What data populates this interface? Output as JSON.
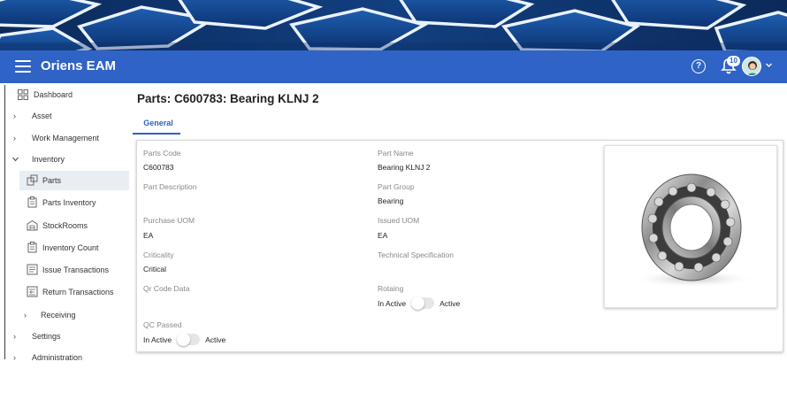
{
  "app": {
    "title": "Oriens EAM",
    "notifications": "10"
  },
  "sidebar": {
    "items": [
      {
        "label": "Dashboard"
      },
      {
        "label": "Asset"
      },
      {
        "label": "Work Management"
      },
      {
        "label": "Inventory"
      },
      {
        "label": "Parts"
      },
      {
        "label": "Parts Inventory"
      },
      {
        "label": "StockRooms"
      },
      {
        "label": "Inventory Count"
      },
      {
        "label": "Issue Transactions"
      },
      {
        "label": "Return Transactions"
      },
      {
        "label": "Receiving"
      },
      {
        "label": "Settings"
      },
      {
        "label": "Administration"
      }
    ]
  },
  "page": {
    "title": "Parts: C600783: Bearing KLNJ 2",
    "tab": "General"
  },
  "fields": {
    "parts_code": {
      "label": "Parts Code",
      "value": "C600783"
    },
    "part_name": {
      "label": "Part Name",
      "value": "Bearing KLNJ 2"
    },
    "part_description": {
      "label": "Part Description",
      "value": ""
    },
    "part_group": {
      "label": "Part Group",
      "value": "Bearing"
    },
    "purchase_uom": {
      "label": "Purchase UOM",
      "value": "EA"
    },
    "issued_uom": {
      "label": "Issued UOM",
      "value": "EA"
    },
    "criticality": {
      "label": "Criticality",
      "value": "Critical"
    },
    "technical_specification": {
      "label": "Technical Specification",
      "value": ""
    },
    "qr_code_data": {
      "label": "Qr Code Data",
      "value": ""
    },
    "rotating": {
      "label": "Rotaing",
      "off_label": "In Active",
      "on_label": "Active"
    },
    "qc_passed": {
      "label": "QC Passed",
      "off_label": "In Active",
      "on_label": "Active"
    }
  },
  "colors": {
    "appbar": "#2f63c6",
    "accent": "#2f63c6",
    "banner": "#0d2f63"
  }
}
